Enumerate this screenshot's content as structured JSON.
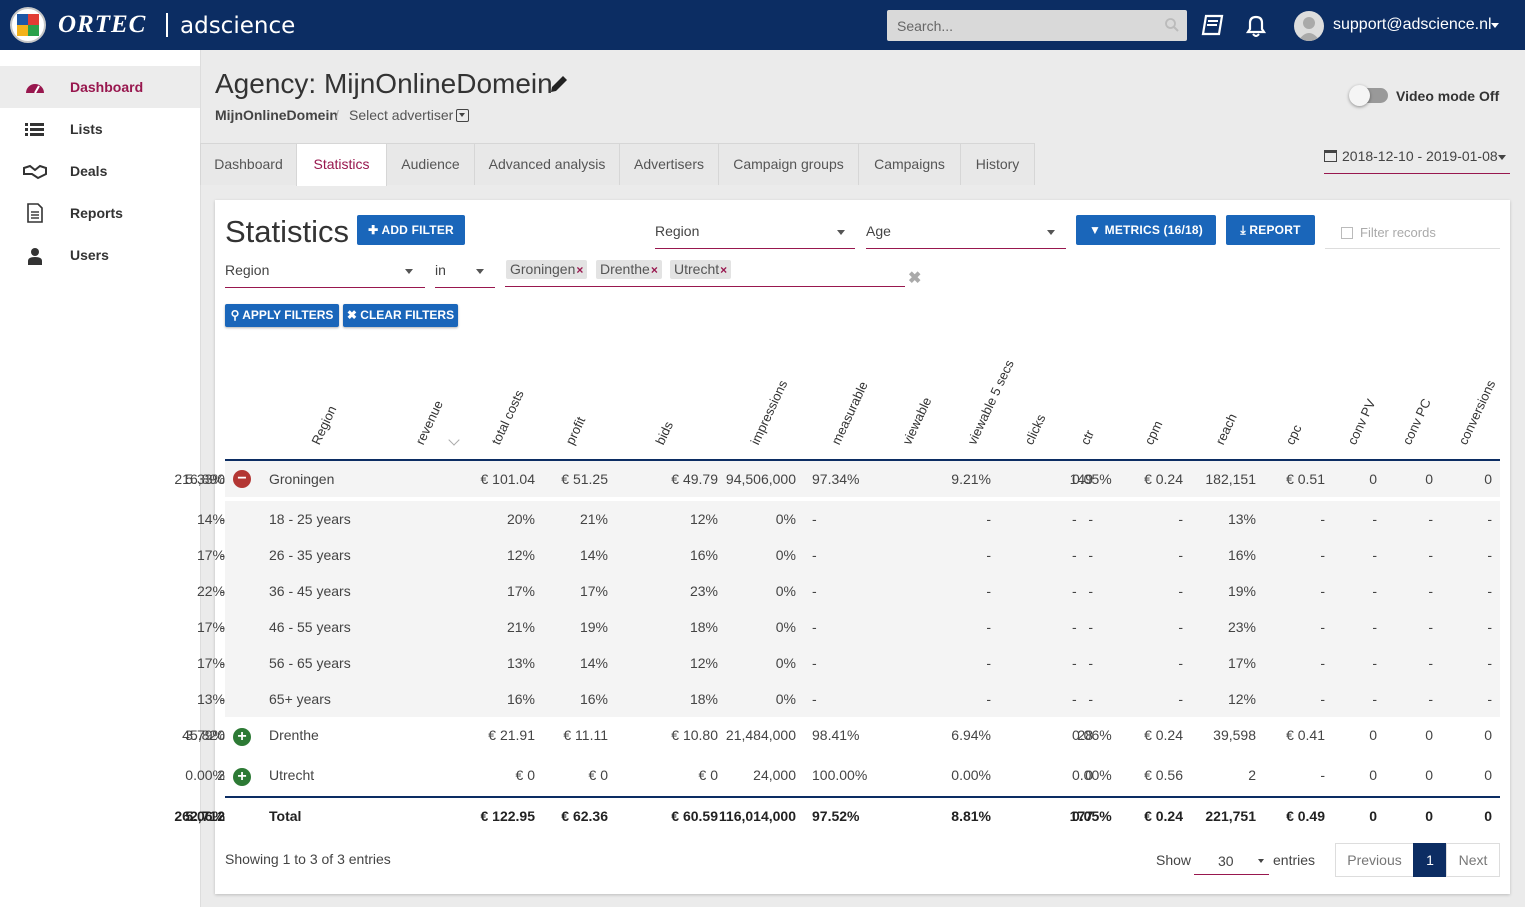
{
  "header": {
    "brand": "ORTEC",
    "product": "adscience",
    "search_placeholder": "Search...",
    "user": "support@adscience.nl"
  },
  "sidebar": {
    "items": [
      {
        "label": "Dashboard",
        "icon": "dashboard-icon",
        "active": true
      },
      {
        "label": "Lists",
        "icon": "list-icon"
      },
      {
        "label": "Deals",
        "icon": "handshake-icon"
      },
      {
        "label": "Reports",
        "icon": "document-icon"
      },
      {
        "label": "Users",
        "icon": "user-icon"
      }
    ]
  },
  "page": {
    "title": "Agency: MijnOnlineDomein",
    "breadcrumb_agency": "MijnOnlineDomein",
    "breadcrumb_sep": "/",
    "breadcrumb_advertiser": "Select advertiser",
    "video_mode": "Video mode Off",
    "date_range": "2018-12-10 - 2019-01-08"
  },
  "tabs": [
    "Dashboard",
    "Statistics",
    "Audience",
    "Advanced analysis",
    "Advertisers",
    "Campaign groups",
    "Campaigns",
    "History"
  ],
  "active_tab": "Statistics",
  "stats": {
    "title": "Statistics",
    "add_filter": "ADD FILTER",
    "group1": "Region",
    "group2": "Age",
    "metrics": "METRICS (16/18)",
    "report": "REPORT",
    "filter_records": "Filter records",
    "filter_field": "Region",
    "filter_op": "in",
    "filter_values": [
      "Groningen",
      "Drenthe",
      "Utrecht"
    ],
    "tag_remove": "×",
    "clear_x": "✖",
    "apply": "APPLY FILTERS",
    "clear": "CLEAR FILTERS"
  },
  "table": {
    "columns": [
      "Region",
      "revenue",
      "total costs",
      "profit",
      "bids",
      "impressions",
      "measurable",
      "viewable",
      "viewable 5 secs",
      "clicks",
      "ctr",
      "cpm",
      "reach",
      "cpc",
      "conv PV",
      "conv PC",
      "conversions"
    ],
    "rows": [
      {
        "icon": "minus",
        "cells": [
          "Groningen",
          "€ 101.04",
          "€ 51.25",
          "€ 49.79",
          "94,506,000",
          "216,890",
          "97.34%",
          "9.21%",
          "5.33%",
          "149",
          "0.05%",
          "€ 0.24",
          "182,151",
          "€ 0.51",
          "0",
          "0",
          "0"
        ]
      },
      {
        "cells": [
          "18 - 25 years",
          "20%",
          "21%",
          "12%",
          "0%",
          "14%",
          "-",
          "-",
          "-",
          "-",
          "-",
          "-",
          "13%",
          "-",
          "-",
          "-",
          "-"
        ]
      },
      {
        "cells": [
          "26 - 35 years",
          "12%",
          "14%",
          "16%",
          "0%",
          "17%",
          "-",
          "-",
          "-",
          "-",
          "-",
          "-",
          "16%",
          "-",
          "-",
          "-",
          "-"
        ]
      },
      {
        "cells": [
          "36 - 45 years",
          "17%",
          "17%",
          "23%",
          "0%",
          "22%",
          "-",
          "-",
          "-",
          "-",
          "-",
          "-",
          "19%",
          "-",
          "-",
          "-",
          "-"
        ]
      },
      {
        "cells": [
          "46 - 55 years",
          "21%",
          "19%",
          "18%",
          "0%",
          "17%",
          "-",
          "-",
          "-",
          "-",
          "-",
          "-",
          "23%",
          "-",
          "-",
          "-",
          "-"
        ]
      },
      {
        "cells": [
          "56 - 65 years",
          "13%",
          "14%",
          "12%",
          "0%",
          "17%",
          "-",
          "-",
          "-",
          "-",
          "-",
          "-",
          "17%",
          "-",
          "-",
          "-",
          "-"
        ]
      },
      {
        "cells": [
          "65+ years",
          "16%",
          "16%",
          "18%",
          "0%",
          "13%",
          "-",
          "-",
          "-",
          "-",
          "-",
          "-",
          "12%",
          "-",
          "-",
          "-",
          "-"
        ]
      },
      {
        "icon": "plus",
        "cells": [
          "Drenthe",
          "€ 21.91",
          "€ 11.11",
          "€ 10.80",
          "21,484,000",
          "45,820",
          "98.41%",
          "6.94%",
          "3.79%",
          "28",
          "0.06%",
          "€ 0.24",
          "39,598",
          "€ 0.41",
          "0",
          "0",
          "0"
        ]
      },
      {
        "icon": "plus",
        "cells": [
          "Utrecht",
          "€ 0",
          "€ 0",
          "€ 0",
          "24,000",
          "2",
          "100.00%",
          "0.00%",
          "0.00%",
          "0",
          "0.00%",
          "€ 0.56",
          "2",
          "-",
          "0",
          "0",
          "0"
        ]
      }
    ],
    "total": [
      "Total",
      "€ 122.95",
      "€ 62.36",
      "€ 60.59",
      "116,014,000",
      "262,712",
      "97.52%",
      "8.81%",
      "5.06%",
      "177",
      "0.05%",
      "€ 0.24",
      "221,751",
      "€ 0.49",
      "0",
      "0",
      "0"
    ]
  },
  "footer": {
    "showing": "Showing 1 to 3 of 3 entries",
    "show": "Show",
    "page_size": "30",
    "entries": "entries",
    "previous": "Previous",
    "page": "1",
    "next": "Next"
  },
  "colors": {
    "navy": "#0c2d63",
    "accent": "#98174e",
    "button": "#1a66ba"
  }
}
